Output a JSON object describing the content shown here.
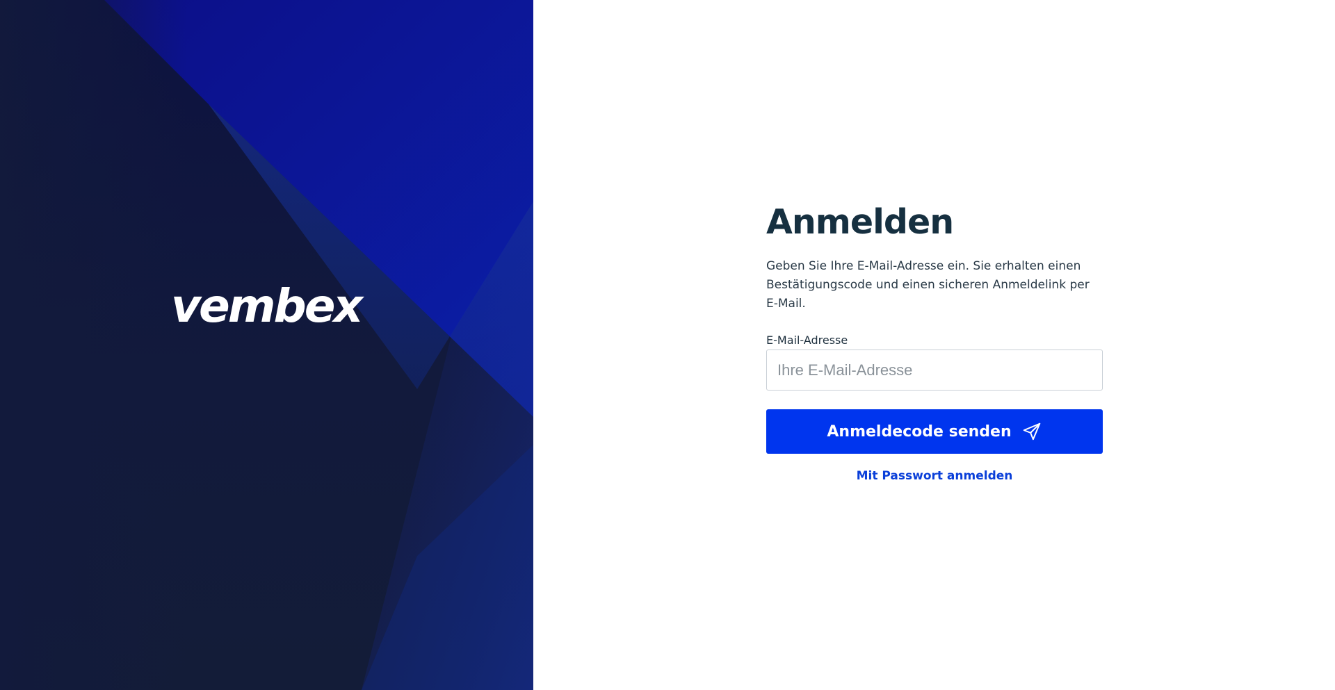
{
  "brand": {
    "logo_text": "vembex",
    "panel_bg": "#121a3c",
    "accent": "#0d0f8f"
  },
  "login": {
    "title": "Anmelden",
    "intro": "Geben Sie Ihre E-Mail-Adresse ein. Sie erhalten einen Bestätigungscode und einen sicheren Anmeldelink per E-Mail.",
    "email_label": "E-Mail-Adresse",
    "email_placeholder": "Ihre E-Mail-Adresse",
    "email_value": "",
    "send_button_label": "Anmeldecode senden",
    "send_button_icon": "paper-plane-icon",
    "password_link_label": "Mit Passwort anmelden",
    "colors": {
      "title": "#163040",
      "primary_button": "#0035ee",
      "link": "#0a3fd9"
    }
  }
}
